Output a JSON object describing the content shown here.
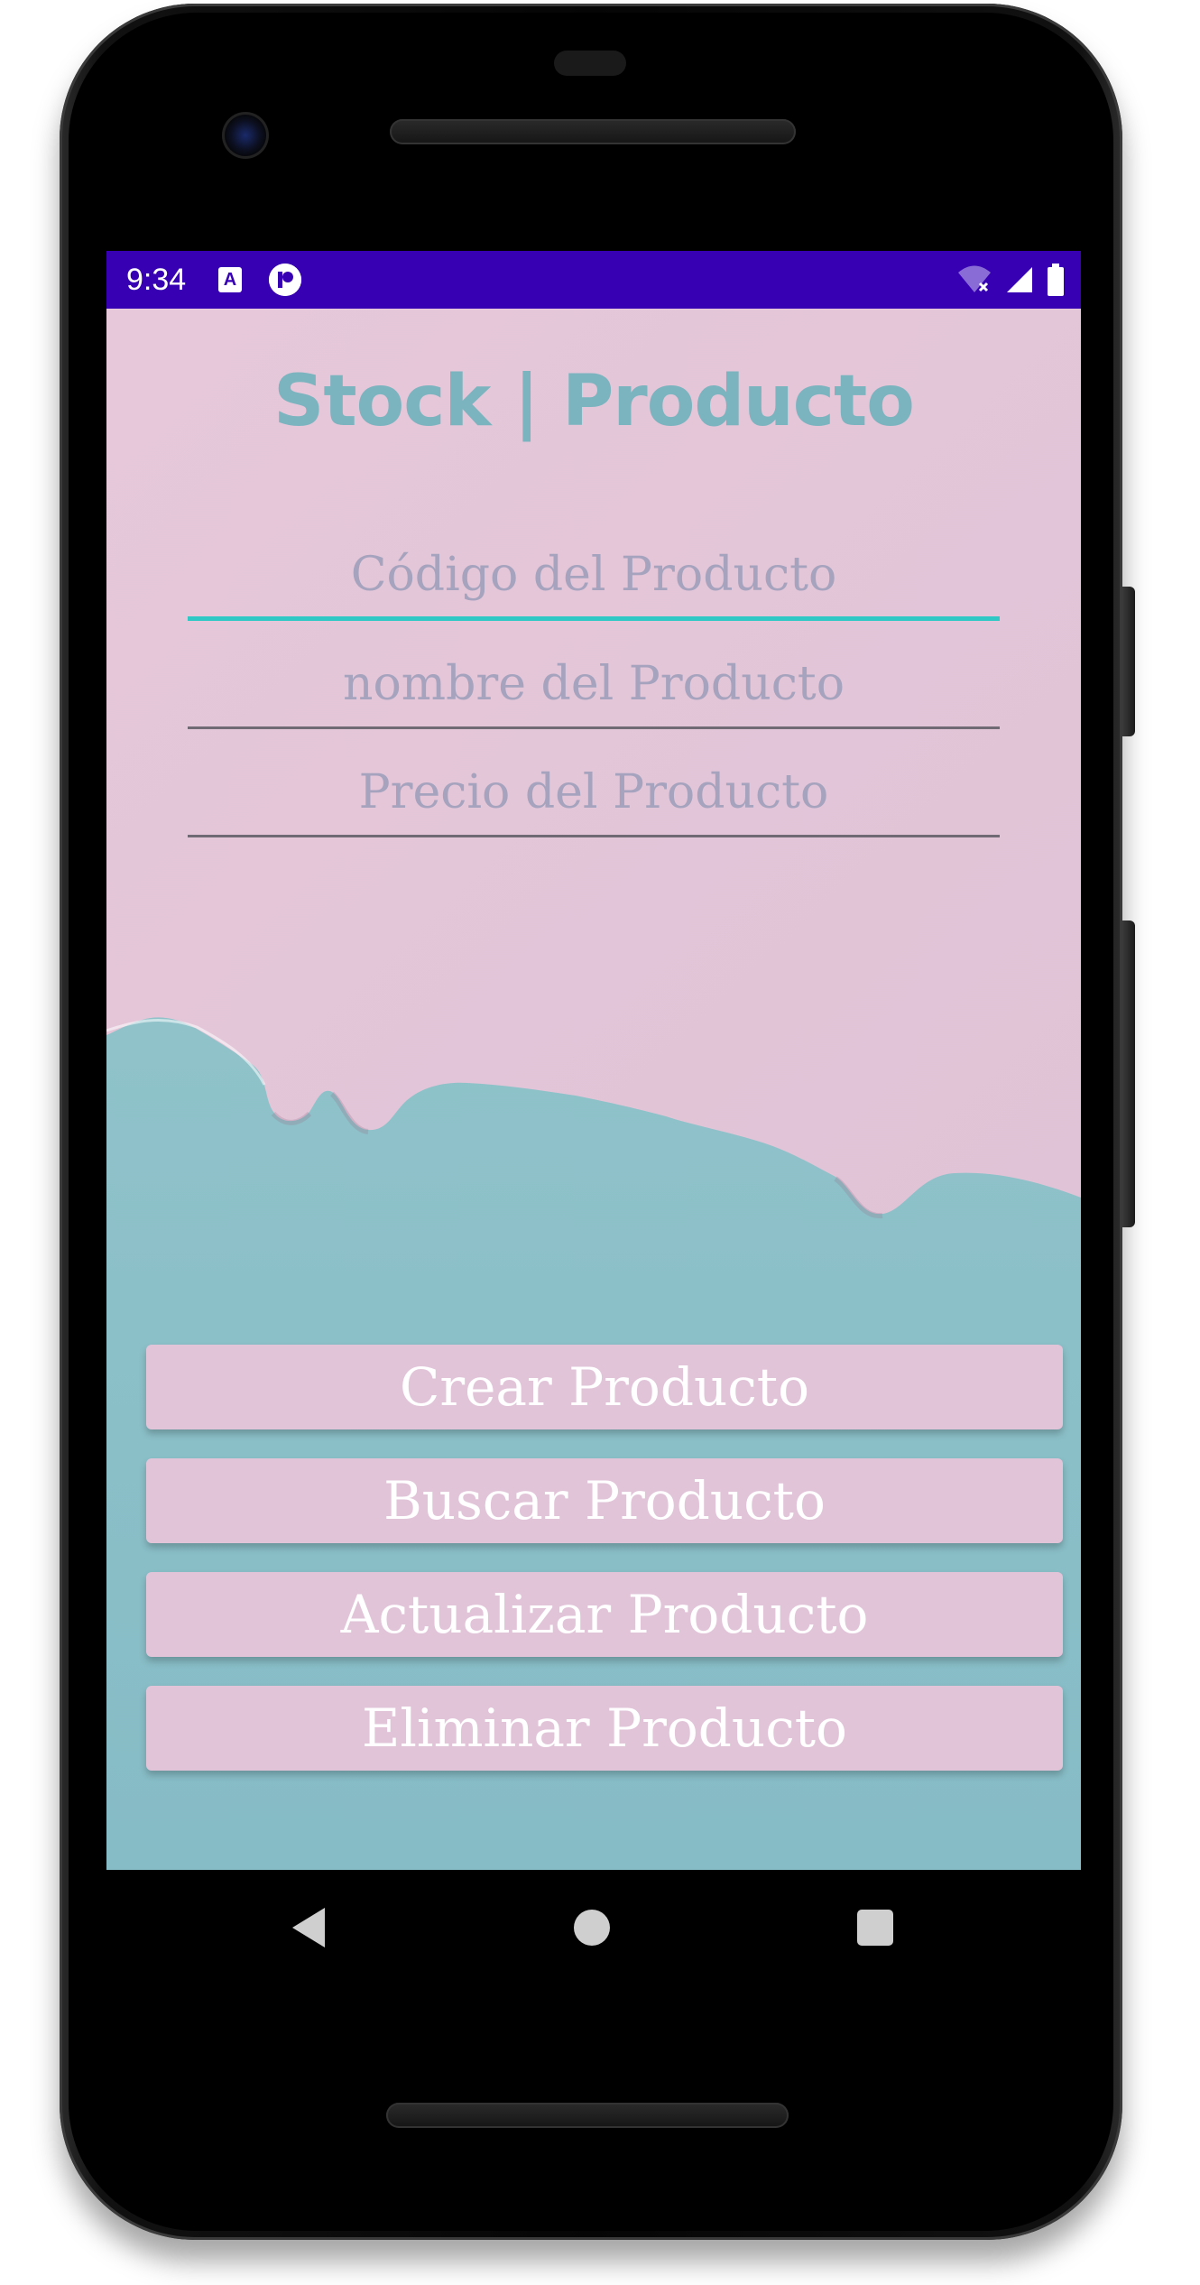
{
  "status_bar": {
    "time": "9:34",
    "notification_a": "A"
  },
  "screen": {
    "title": "Stock | Producto",
    "fields": [
      {
        "placeholder": "Código del Producto",
        "value": "",
        "focused": true
      },
      {
        "placeholder": "nombre del Producto",
        "value": "",
        "focused": false
      },
      {
        "placeholder": "Precio del Producto",
        "value": "",
        "focused": false
      }
    ],
    "buttons": [
      {
        "label": "Crear Producto"
      },
      {
        "label": "Buscar Producto"
      },
      {
        "label": "Actualizar Producto"
      },
      {
        "label": "Eliminar Producto"
      }
    ]
  },
  "colors": {
    "status_bar": "#3700b3",
    "title": "#7bb4bf",
    "background_pink": "#e2c4d7",
    "background_teal": "#8fc1c7",
    "button": "#e2c4d9",
    "focus_underline": "#2fc8c4"
  },
  "icons": {
    "status_left": [
      "notification-a-icon",
      "notification-p-icon"
    ],
    "status_right": [
      "wifi-icon",
      "cell-signal-icon",
      "battery-icon"
    ],
    "nav": [
      "back-icon",
      "home-icon",
      "recents-icon"
    ]
  }
}
